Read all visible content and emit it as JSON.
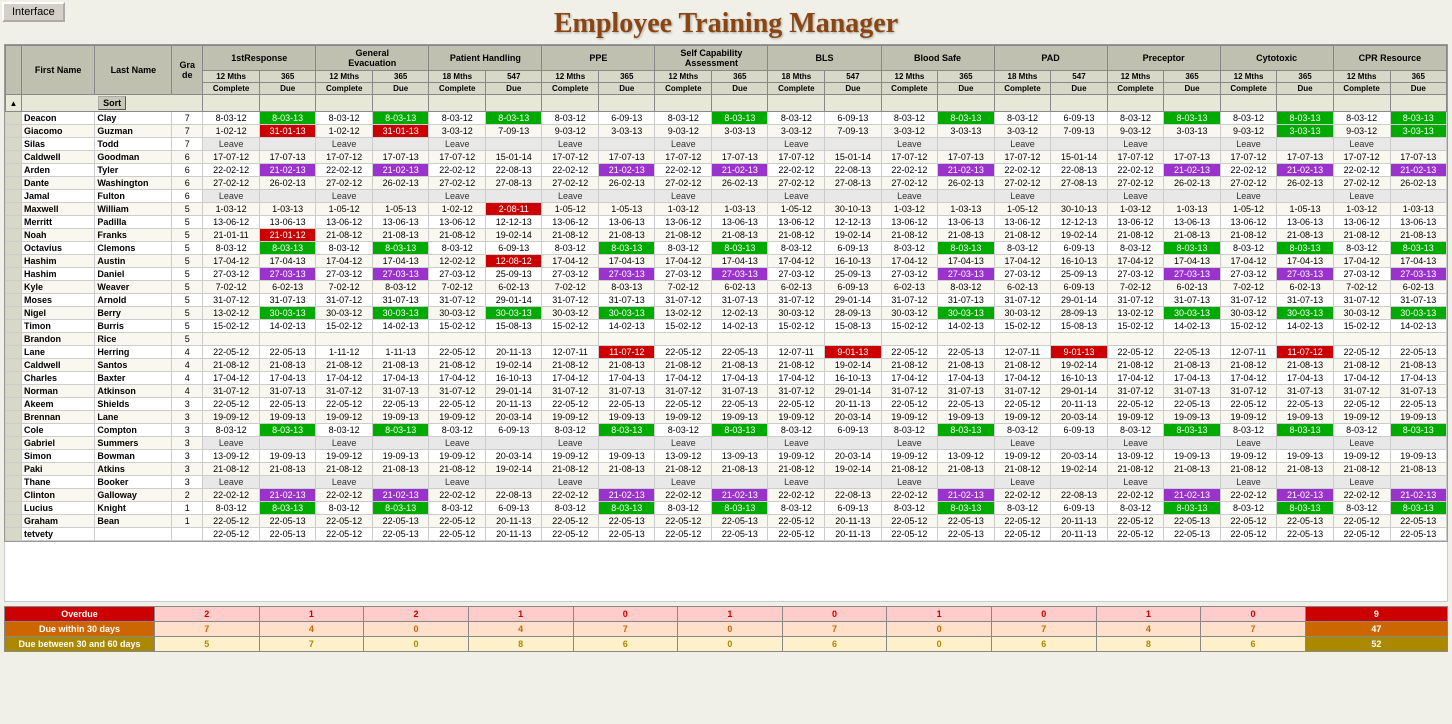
{
  "app": {
    "interface_btn": "Interface",
    "title": "Employee Training Manager"
  },
  "columns": [
    {
      "label": "First Name",
      "span": 1
    },
    {
      "label": "Last Name",
      "span": 1
    },
    {
      "label": "Gra de",
      "span": 1
    },
    {
      "label": "1stResponse",
      "span": 1
    },
    {
      "label": "General Evacuation",
      "span": 1
    },
    {
      "label": "Patient Handling",
      "span": 1
    },
    {
      "label": "PPE",
      "span": 1
    },
    {
      "label": "Self Capability Assessment",
      "span": 1
    },
    {
      "label": "BLS",
      "span": 1
    },
    {
      "label": "Blood Safe",
      "span": 1
    },
    {
      "label": "PAD",
      "span": 1
    },
    {
      "label": "Preceptor",
      "span": 1
    },
    {
      "label": "Cytotoxic",
      "span": 1
    },
    {
      "label": "CPR Resource",
      "span": 1
    }
  ],
  "subheaders": {
    "name_cols": [
      "Complete",
      "Due"
    ],
    "period_1stResponse": "12 Mths",
    "val_1stResponse": 365,
    "period_GenEvac": "12 Mths",
    "val_GenEvac": 365,
    "period_PatHandling": "18 Mths",
    "val_PatHandling": 547,
    "period_PPE": "12 Mths",
    "val_PPE": 365,
    "period_SelfCap": "12 Mths",
    "val_SelfCap": 365,
    "period_BLS": "18 Mths",
    "val_BLS": 547,
    "period_BloodSafe": "12 Mths",
    "val_BloodSafe": 365,
    "period_PAD": "18 Mths",
    "val_PAD": 547,
    "period_Preceptor": "12 Mths",
    "val_Preceptor": 365,
    "period_Cytotoxic": "12 Mths",
    "val_Cytotoxic": 365,
    "period_CPR": "12 Mths",
    "val_CPR": 365
  },
  "sort_label": "Sort",
  "summary": {
    "overdue_label": "Overdue",
    "due30_label": "Due within 30 days",
    "due60_label": "Due between 30 and 60 days",
    "rows": [
      {
        "type": "overdue",
        "vals": [
          2,
          1,
          2,
          1,
          0,
          1,
          0,
          1,
          0,
          1,
          0,
          9
        ]
      },
      {
        "type": "30days",
        "vals": [
          7,
          4,
          0,
          4,
          7,
          0,
          7,
          0,
          7,
          4,
          7,
          47
        ]
      },
      {
        "type": "60days",
        "vals": [
          5,
          7,
          0,
          8,
          6,
          0,
          6,
          0,
          6,
          8,
          6,
          52
        ]
      }
    ]
  }
}
